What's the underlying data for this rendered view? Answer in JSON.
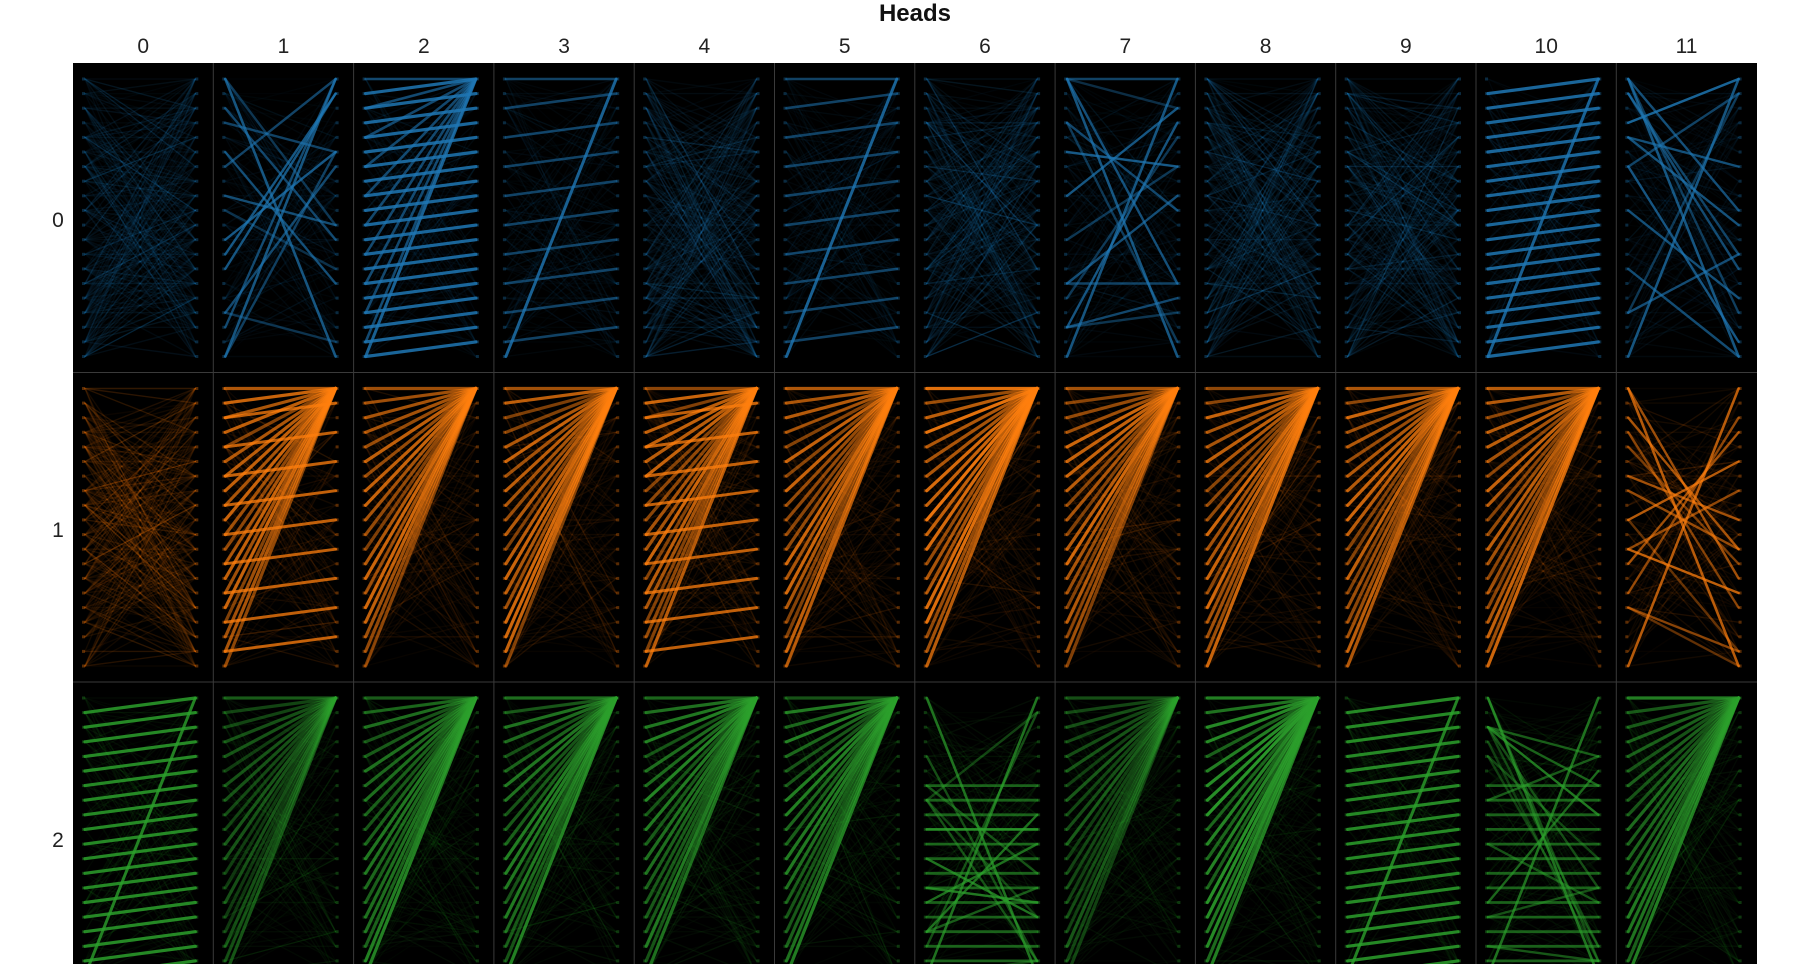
{
  "figure": {
    "title": "Heads",
    "head_labels": [
      "0",
      "1",
      "2",
      "3",
      "4",
      "5",
      "6",
      "7",
      "8",
      "9",
      "10",
      "11"
    ],
    "layer_labels": [
      "0",
      "1",
      "2"
    ],
    "layer_colors": [
      "#1f77b4",
      "#ff7f0e",
      "#2ca02c"
    ],
    "background_color": "#000000",
    "tokens_per_side": 20,
    "patterns": [
      [
        "broad",
        "cross",
        "stripe-top",
        "diagonal-mix",
        "broad",
        "shift-line",
        "broad",
        "cross-light",
        "broad",
        "broad",
        "stripe-dense",
        "mixed-cross"
      ],
      [
        "broad-heavy",
        "fan-stripe",
        "fan",
        "fan",
        "fan-stripe",
        "fan",
        "fan-strong",
        "fan",
        "fan",
        "fan",
        "fan",
        "mixed-cross"
      ],
      [
        "stripe-dense",
        "fan-light",
        "fan",
        "fan",
        "fan",
        "fan",
        "crossing",
        "fan-light",
        "fan-strong",
        "stripe-dense",
        "crossing",
        "fan"
      ]
    ]
  }
}
